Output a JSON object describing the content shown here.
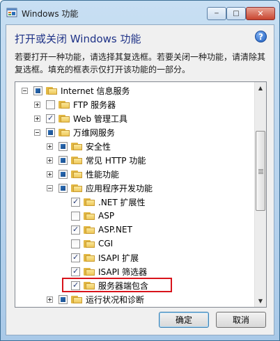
{
  "window": {
    "title": "Windows 功能"
  },
  "caption_buttons": {
    "minimize": "─",
    "maximize": "□",
    "close": "✕"
  },
  "heading": "打开或关闭 Windows 功能",
  "help": "?",
  "description": "若要打开一种功能，请选择其复选框。若要关闭一种功能，请清除其复选框。填充的框表示仅打开该功能的一部分。",
  "tree": {
    "nodes": [
      {
        "label": "Internet 信息服务",
        "level": 0,
        "expander": "minus",
        "check": "partial"
      },
      {
        "label": "FTP 服务器",
        "level": 1,
        "expander": "plus",
        "check": "unchecked"
      },
      {
        "label": "Web 管理工具",
        "level": 1,
        "expander": "plus",
        "check": "checked"
      },
      {
        "label": "万维网服务",
        "level": 1,
        "expander": "minus",
        "check": "partial"
      },
      {
        "label": "安全性",
        "level": 2,
        "expander": "plus",
        "check": "partial"
      },
      {
        "label": "常见 HTTP 功能",
        "level": 2,
        "expander": "plus",
        "check": "partial"
      },
      {
        "label": "性能功能",
        "level": 2,
        "expander": "plus",
        "check": "partial"
      },
      {
        "label": "应用程序开发功能",
        "level": 2,
        "expander": "minus",
        "check": "partial"
      },
      {
        "label": ".NET 扩展性",
        "level": 3,
        "expander": "none",
        "check": "checked"
      },
      {
        "label": "ASP",
        "level": 3,
        "expander": "none",
        "check": "unchecked"
      },
      {
        "label": "ASP.NET",
        "level": 3,
        "expander": "none",
        "check": "checked"
      },
      {
        "label": "CGI",
        "level": 3,
        "expander": "none",
        "check": "unchecked"
      },
      {
        "label": "ISAPI 扩展",
        "level": 3,
        "expander": "none",
        "check": "checked"
      },
      {
        "label": "ISAPI 筛选器",
        "level": 3,
        "expander": "none",
        "check": "checked"
      },
      {
        "label": "服务器端包含",
        "level": 3,
        "expander": "none",
        "check": "checked"
      },
      {
        "label": "运行状况和诊断",
        "level": 2,
        "expander": "plus",
        "check": "partial"
      }
    ]
  },
  "buttons": {
    "ok": "确定",
    "cancel": "取消"
  },
  "colors": {
    "highlight": "#d8131b",
    "heading": "#1e3287"
  }
}
